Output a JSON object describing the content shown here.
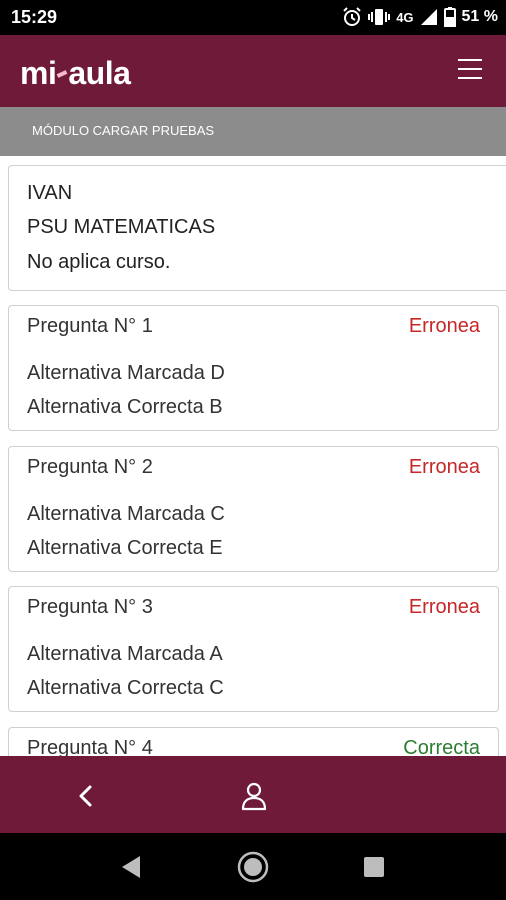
{
  "status_bar": {
    "time": "15:29",
    "network": "4G",
    "battery": "51 %",
    "icons": [
      "alarm-icon",
      "vibrate-icon",
      "signal-icon",
      "battery-icon"
    ]
  },
  "app_bar": {
    "logo_left": "mi",
    "logo_right": "aula",
    "menu_icon": "hamburger-menu-icon"
  },
  "module": {
    "title": "MÓDULO CARGAR PRUEBAS"
  },
  "student": {
    "name": "IVAN",
    "subject": "PSU MATEMATICAS",
    "course": "No aplica curso."
  },
  "questions": [
    {
      "title": "Pregunta N° 1",
      "status": "Erronea",
      "marked": "Alternativa Marcada D",
      "correct": "Alternativa Correcta B"
    },
    {
      "title": "Pregunta N° 2",
      "status": "Erronea",
      "marked": "Alternativa Marcada C",
      "correct": "Alternativa Correcta E"
    },
    {
      "title": "Pregunta N° 3",
      "status": "Erronea",
      "marked": "Alternativa Marcada A",
      "correct": "Alternativa Correcta C"
    },
    {
      "title": "Pregunta N° 4",
      "status": "Correcta",
      "marked": "",
      "correct": ""
    }
  ],
  "colors": {
    "brand": "#701a3a",
    "module_bar": "#8c8c8c",
    "error": "#c62828",
    "success": "#2e7d32"
  },
  "bottom_nav": {
    "back_icon": "chevron-left-icon",
    "profile_icon": "user-icon"
  },
  "system_nav": [
    "back-triangle-icon",
    "home-circle-icon",
    "recents-square-icon"
  ]
}
